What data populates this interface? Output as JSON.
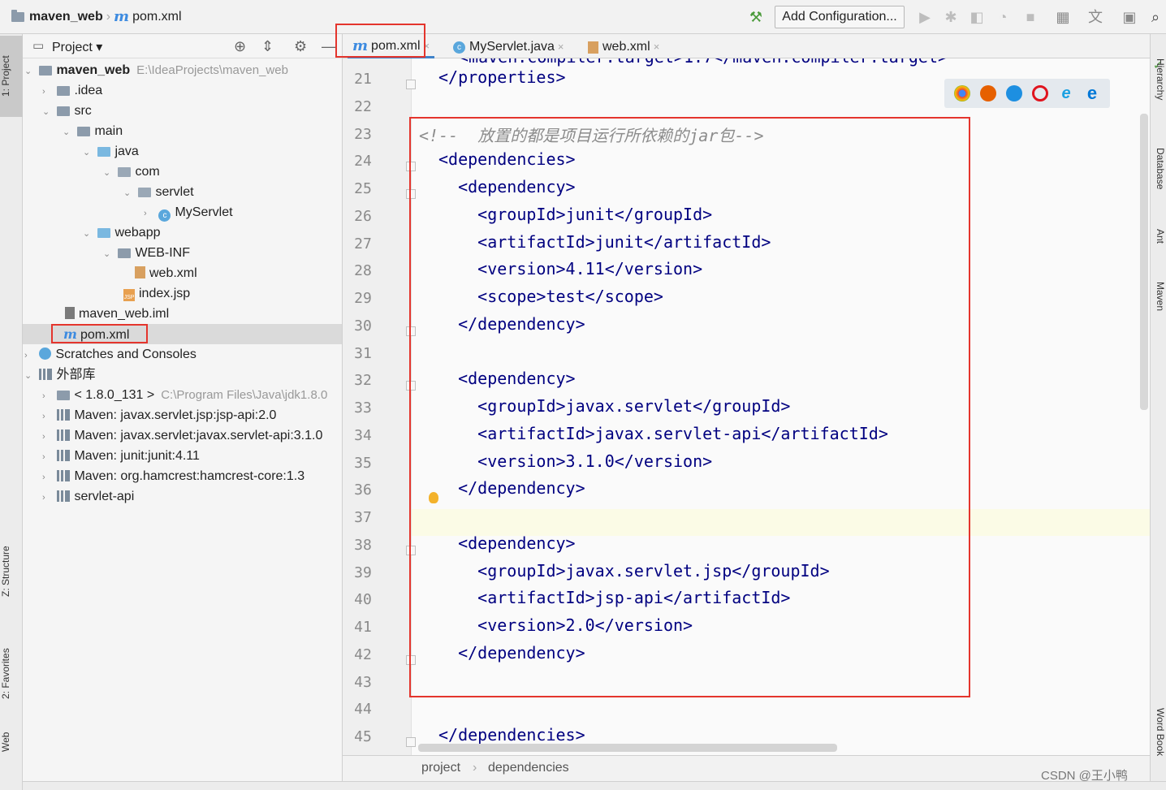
{
  "navbar": {
    "project_name": "maven_web",
    "file_name": "pom.xml",
    "add_config_label": "Add Configuration..."
  },
  "left_strip": {
    "tabs": [
      "1: Project",
      "Z: Structure",
      "2: Favorites",
      "Web"
    ]
  },
  "project_panel": {
    "title": "Project",
    "tree": [
      {
        "label": "maven_web",
        "path": "E:\\IdeaProjects\\maven_web",
        "icon": "module-folder-icon",
        "depth": 0,
        "expanded": true
      },
      {
        "label": ".idea",
        "icon": "folder-icon",
        "depth": 1,
        "expanded": false
      },
      {
        "label": "src",
        "icon": "folder-icon",
        "depth": 1,
        "expanded": true
      },
      {
        "label": "main",
        "icon": "folder-icon",
        "depth": 2,
        "expanded": true
      },
      {
        "label": "java",
        "icon": "source-folder-icon",
        "depth": 3,
        "expanded": true
      },
      {
        "label": "com",
        "icon": "package-icon",
        "depth": 4,
        "expanded": true
      },
      {
        "label": "servlet",
        "icon": "package-icon",
        "depth": 5,
        "expanded": true
      },
      {
        "label": "MyServlet",
        "icon": "class-icon",
        "depth": 6,
        "expanded": false
      },
      {
        "label": "webapp",
        "icon": "web-folder-icon",
        "depth": 3,
        "expanded": true
      },
      {
        "label": "WEB-INF",
        "icon": "folder-icon",
        "depth": 4,
        "expanded": true
      },
      {
        "label": "web.xml",
        "icon": "xml-file-icon",
        "depth": 5
      },
      {
        "label": "index.jsp",
        "icon": "jsp-file-icon",
        "depth": 4
      },
      {
        "label": "maven_web.iml",
        "icon": "iml-file-icon",
        "depth": 2
      },
      {
        "label": "pom.xml",
        "icon": "maven-file-icon",
        "depth": 2,
        "selected": true
      },
      {
        "label": "Scratches and Consoles",
        "icon": "scratches-icon",
        "depth": 0,
        "expanded": false
      },
      {
        "label": "外部库",
        "icon": "library-icon",
        "depth": 0,
        "expanded": true
      },
      {
        "label": "< 1.8.0_131 >",
        "path": "C:\\Program Files\\Java\\jdk1.8.0",
        "icon": "jdk-icon",
        "depth": 1,
        "expanded": false
      },
      {
        "label": "Maven: javax.servlet.jsp:jsp-api:2.0",
        "icon": "library-icon",
        "depth": 1,
        "expanded": false
      },
      {
        "label": "Maven: javax.servlet:javax.servlet-api:3.1.0",
        "icon": "library-icon",
        "depth": 1,
        "expanded": false
      },
      {
        "label": "Maven: junit:junit:4.11",
        "icon": "library-icon",
        "depth": 1,
        "expanded": false
      },
      {
        "label": "Maven: org.hamcrest:hamcrest-core:1.3",
        "icon": "library-icon",
        "depth": 1,
        "expanded": false
      },
      {
        "label": "servlet-api",
        "icon": "library-icon",
        "depth": 1,
        "expanded": false
      }
    ]
  },
  "tabs": [
    {
      "label": "pom.xml",
      "icon": "maven-file-icon",
      "active": true
    },
    {
      "label": "MyServlet.java",
      "icon": "class-icon",
      "active": false
    },
    {
      "label": "web.xml",
      "icon": "xml-file-icon",
      "active": false
    }
  ],
  "editor": {
    "partial_top_line": "<maven.compiler.target>1.7</maven.compiler.target>",
    "lines": [
      {
        "n": "21",
        "text": "</properties>"
      },
      {
        "n": "22",
        "text": ""
      },
      {
        "n": "23",
        "text": "<!--  放置的都是项目运行所依赖的jar包-->",
        "comment": true
      },
      {
        "n": "24",
        "text": "<dependencies>"
      },
      {
        "n": "25",
        "text": "  <dependency>"
      },
      {
        "n": "26",
        "text": "    <groupId>junit</groupId>"
      },
      {
        "n": "27",
        "text": "    <artifactId>junit</artifactId>"
      },
      {
        "n": "28",
        "text": "    <version>4.11</version>"
      },
      {
        "n": "29",
        "text": "    <scope>test</scope>"
      },
      {
        "n": "30",
        "text": "  </dependency>"
      },
      {
        "n": "31",
        "text": ""
      },
      {
        "n": "32",
        "text": "  <dependency>"
      },
      {
        "n": "33",
        "text": "    <groupId>javax.servlet</groupId>"
      },
      {
        "n": "34",
        "text": "    <artifactId>javax.servlet-api</artifactId>"
      },
      {
        "n": "35",
        "text": "    <version>3.1.0</version>"
      },
      {
        "n": "36",
        "text": "  </dependency>"
      },
      {
        "n": "37",
        "text": ""
      },
      {
        "n": "38",
        "text": "  <dependency>"
      },
      {
        "n": "39",
        "text": "    <groupId>javax.servlet.jsp</groupId>"
      },
      {
        "n": "40",
        "text": "    <artifactId>jsp-api</artifactId>"
      },
      {
        "n": "41",
        "text": "    <version>2.0</version>"
      },
      {
        "n": "42",
        "text": "  </dependency>"
      },
      {
        "n": "43",
        "text": ""
      },
      {
        "n": "44",
        "text": ""
      },
      {
        "n": "45",
        "text": "</dependencies>"
      }
    ],
    "browser_icons": [
      "chrome-icon",
      "firefox-icon",
      "safari-icon",
      "opera-icon",
      "ie-icon",
      "edge-icon"
    ]
  },
  "right_strip": {
    "tabs": [
      "Hierarchy",
      "Database",
      "Ant",
      "Maven",
      "Word Book"
    ]
  },
  "breadcrumb": {
    "items": [
      "project",
      "dependencies"
    ]
  },
  "watermark": "CSDN @王小鸭"
}
